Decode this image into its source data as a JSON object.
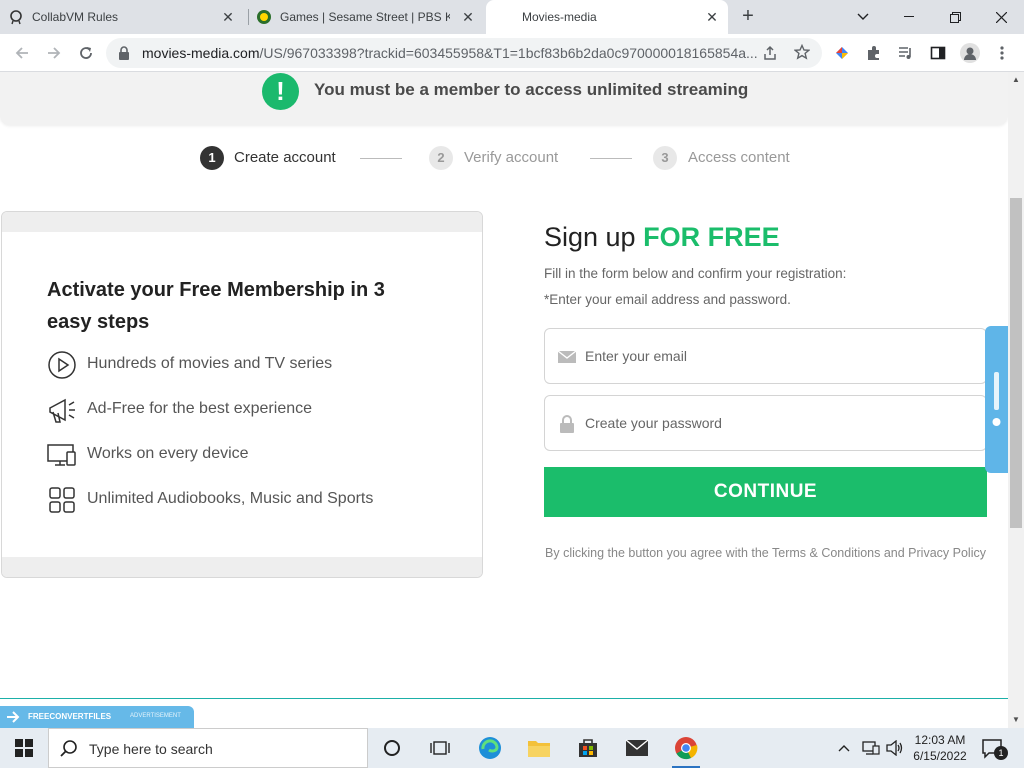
{
  "browser": {
    "tabs": [
      {
        "title": "CollabVM Rules",
        "active": false
      },
      {
        "title": "Games | Sesame Street | PBS KIDS",
        "active": false
      },
      {
        "title": "Movies-media",
        "active": true
      }
    ],
    "url_host": "movies-media.com",
    "url_path": "/US/967033398?trackid=603455958&T1=1bcf83b6b2da0c970000018165854a..."
  },
  "banner": {
    "icon": "!",
    "message": "You must be a member to access unlimited streaming"
  },
  "steps": [
    {
      "num": "1",
      "label": "Create account"
    },
    {
      "num": "2",
      "label": "Verify account"
    },
    {
      "num": "3",
      "label": "Access content"
    }
  ],
  "card": {
    "heading": "Activate your Free Membership in 3 easy steps",
    "features": [
      {
        "icon": "play-icon",
        "text": "Hundreds of movies and TV series"
      },
      {
        "icon": "megaphone-icon",
        "text": "Ad-Free for the best experience"
      },
      {
        "icon": "devices-icon",
        "text": "Works on every device"
      },
      {
        "icon": "grid-icon",
        "text": "Unlimited Audiobooks, Music and Sports"
      }
    ]
  },
  "signup": {
    "title_prefix": "Sign up ",
    "title_accent": "FOR FREE",
    "subtitle1": "Fill in the form below and confirm your registration:",
    "subtitle2": "*Enter your email address and password.",
    "email_placeholder": "Enter your email",
    "password_placeholder": "Create your password",
    "button": "CONTINUE",
    "terms": "By clicking the button you agree with the Terms & Conditions and Privacy Policy"
  },
  "ad": {
    "brand": "FREECONVERTFILES",
    "label": "ADVERTISEMENT"
  },
  "taskbar": {
    "search_placeholder": "Type here to search",
    "time": "12:03 AM",
    "date": "6/15/2022",
    "notification_count": "1"
  },
  "colors": {
    "accent_green": "#1bbd6b",
    "taskbar_bg": "#e6ecf2"
  }
}
